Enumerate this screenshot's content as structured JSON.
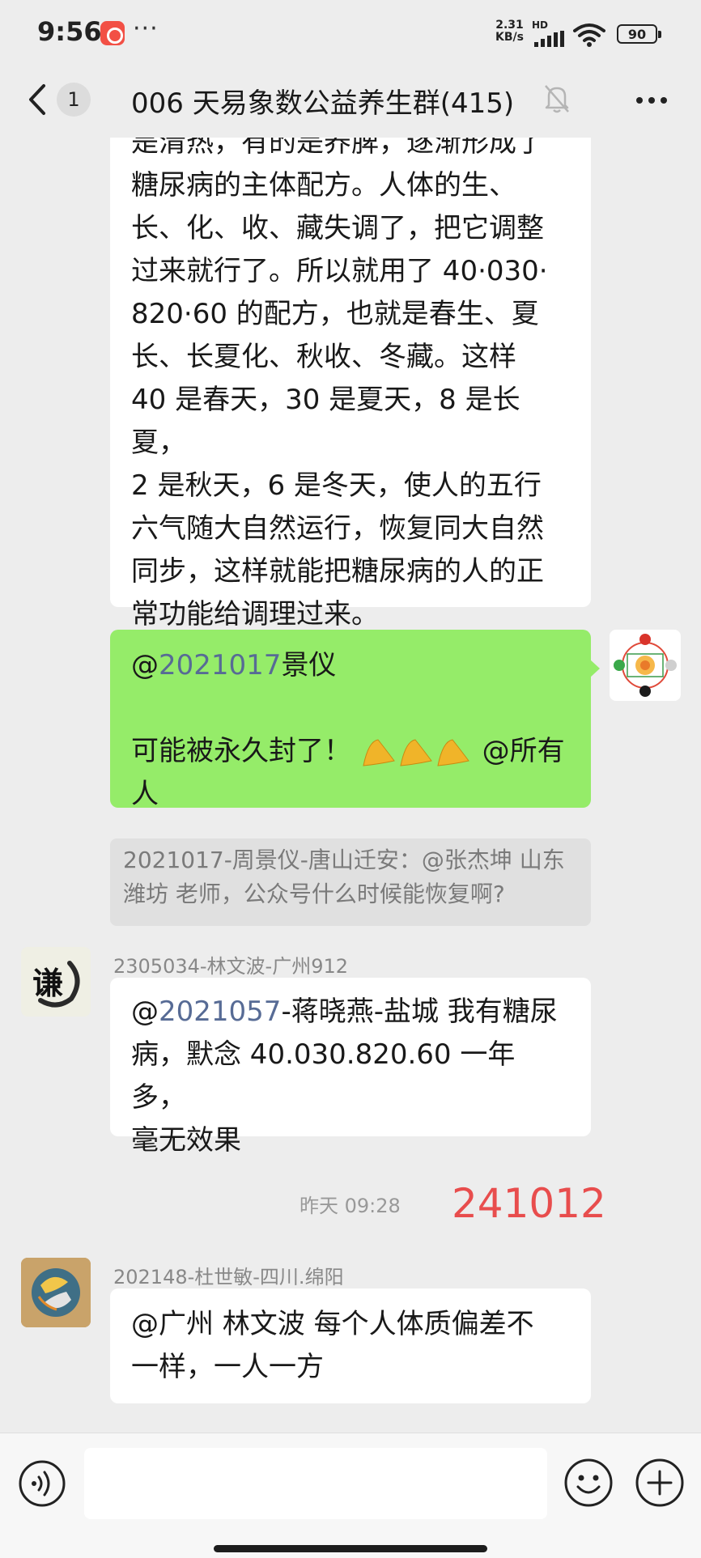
{
  "status_bar": {
    "time": "9:56",
    "more_dots": "···",
    "net_speed_value": "2.31",
    "net_speed_unit": "KB/s",
    "hd_label": "HD",
    "battery": "90"
  },
  "header": {
    "unread_count": "1",
    "title": "006 天易象数公益养生群(415)"
  },
  "messages": {
    "m1": {
      "lines": [
        "是清热，有的是养脾，逐渐形成了",
        "糖尿病的主体配方。人体的生、",
        "长、化、收、藏失调了，把它调整",
        "过来就行了。所以就用了 40·030·",
        "820·60 的配方，也就是春生、夏",
        "长、长夏化、秋收、冬藏。这样",
        "40 是春天，30 是夏天，8 是长夏，",
        "2 是秋天，6 是冬天，使人的五行",
        "六气随大自然运行，恢复同大自然",
        "同步，这样就能把糖尿病的人的正",
        "常功能给调理过来。"
      ]
    },
    "m2": {
      "mention_prefix": "@",
      "mention_id": "2021017",
      "mention_name": "景仪",
      "line2": "可能被永久封了！",
      "line2_suffix": "@所有",
      "line3": "人",
      "quote": "2021017-周景仪-唐山迁安：@张杰坤 山东潍坊 老师，公众号什么时候能恢复啊?"
    },
    "m3": {
      "sender": "2305034-林文波-广州912",
      "avatar_char": "谦",
      "mention_prefix": "@",
      "mention_id": "2021057",
      "line1_rest": "-蒋晓燕-盐城  我有糖尿",
      "line2": "病，默念 40.030.820.60 一年多，",
      "line3": "毫无效果"
    },
    "timestamp": "昨天 09:28",
    "red_label": "241012",
    "m4": {
      "sender": "202148-杜世敏-四川.绵阳",
      "line1": "@广州 林文波  每个人体质偏差不",
      "line2": "一样，一人一方"
    }
  },
  "colors": {
    "bubble_green": "#95ec69",
    "mention_blue": "#576b95",
    "red_label": "#e84d4d"
  }
}
